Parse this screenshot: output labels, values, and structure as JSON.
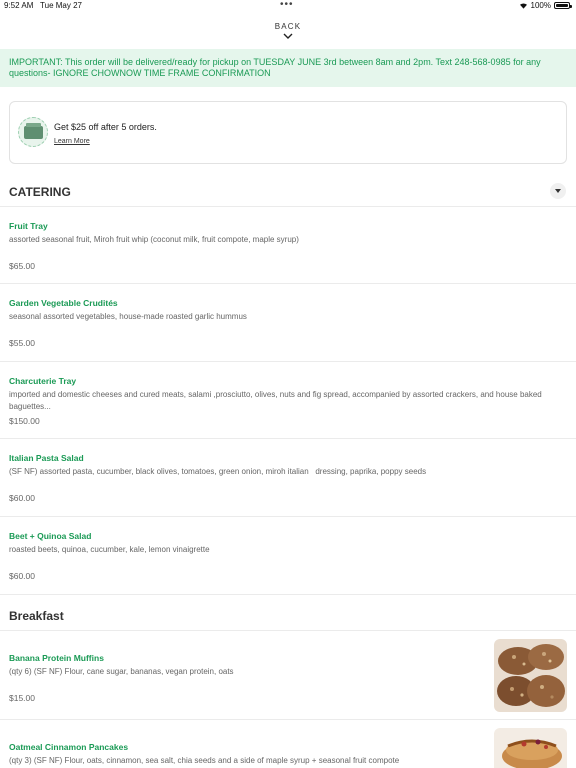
{
  "status": {
    "time": "9:52 AM",
    "date": "Tue May 27",
    "battery": "100%"
  },
  "nav": {
    "back_label": "BACK"
  },
  "banner": {
    "text": "IMPORTANT: This order will be delivered/ready for pickup on TUESDAY JUNE 3rd between 8am and 2pm. Text 248-568-0985 for any questions- IGNORE CHOWNOW TIME FRAME CONFIRMATION"
  },
  "promo": {
    "text": "Get $25 off after 5 orders.",
    "link": "Learn More"
  },
  "sections": {
    "catering": {
      "title": "CATERING",
      "items": [
        {
          "name": "Fruit Tray",
          "desc": "assorted seasonal fruit, Miroh fruit whip (coconut milk, fruit compote, maple syrup)",
          "price": "$65.00"
        },
        {
          "name": "Garden Vegetable Crudités",
          "desc": "seasonal assorted vegetables, house-made roasted garlic hummus",
          "price": "$55.00"
        },
        {
          "name": "Charcuterie Tray",
          "desc": "imported and domestic cheeses and cured meats, salami ,prosciutto, olives, nuts and fig spread, accompanied by assorted crackers, and house baked baguettes...",
          "price": "$150.00"
        },
        {
          "name": "Italian Pasta Salad",
          "desc": "(SF NF) assorted pasta, cucumber, black olives, tomatoes, green onion, miroh italian   dressing, paprika, poppy seeds",
          "price": "$60.00"
        },
        {
          "name": "Beet + Quinoa Salad",
          "desc": "roasted beets, quinoa, cucumber, kale, lemon vinaigrette",
          "price": "$60.00"
        }
      ]
    },
    "breakfast": {
      "title": "Breakfast",
      "items": [
        {
          "name": "Banana Protein Muffins",
          "desc": "(qty 6) (SF NF) Flour, cane sugar, bananas, vegan protein, oats",
          "price": "$15.00"
        },
        {
          "name": "Oatmeal Cinnamon Pancakes",
          "desc": "(qty 3) (SF NF) Flour, oats, cinnamon, sea salt, chia seeds and a side of maple syrup + seasonal fruit compote"
        }
      ]
    }
  }
}
